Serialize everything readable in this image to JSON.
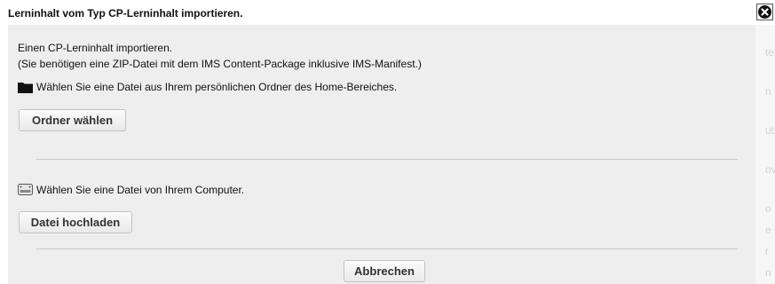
{
  "dialog": {
    "title": "Lerninhalt vom Typ CP-Lerninhalt importieren.",
    "close_icon": "close-circle-icon"
  },
  "intro": {
    "line1": "Einen CP-Lerninhalt importieren.",
    "line2": "(Sie benötigen eine ZIP-Datei mit dem IMS Content-Package inklusive IMS-Manifest.)"
  },
  "home_section": {
    "icon": "folder-icon",
    "text": "Wählen Sie eine Datei aus Ihrem persönlichen Ordner des Home-Bereiches.",
    "button_label": "Ordner wählen"
  },
  "computer_section": {
    "icon": "hard-drive-icon",
    "text": "Wählen Sie eine Datei von Ihrem Computer.",
    "button_label": "Datei hochladen"
  },
  "footer": {
    "cancel_label": "Abbrechen"
  },
  "background_right": [
    "te",
    "n",
    "ut",
    "ov",
    "o",
    "e",
    "r",
    "n"
  ]
}
